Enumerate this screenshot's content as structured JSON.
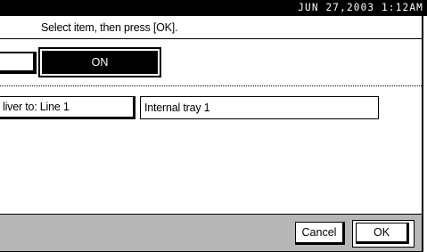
{
  "status_bar": {
    "datetime": "JUN  27,2003  1:12AM"
  },
  "header": {
    "message": "Select item, then press [OK]."
  },
  "toggle": {
    "on_label": "ON",
    "selected": "ON"
  },
  "delivery": {
    "button_label": "liver to: Line 1",
    "value": "Internal tray 1"
  },
  "footer": {
    "cancel_label": "Cancel",
    "ok_label": "OK"
  }
}
